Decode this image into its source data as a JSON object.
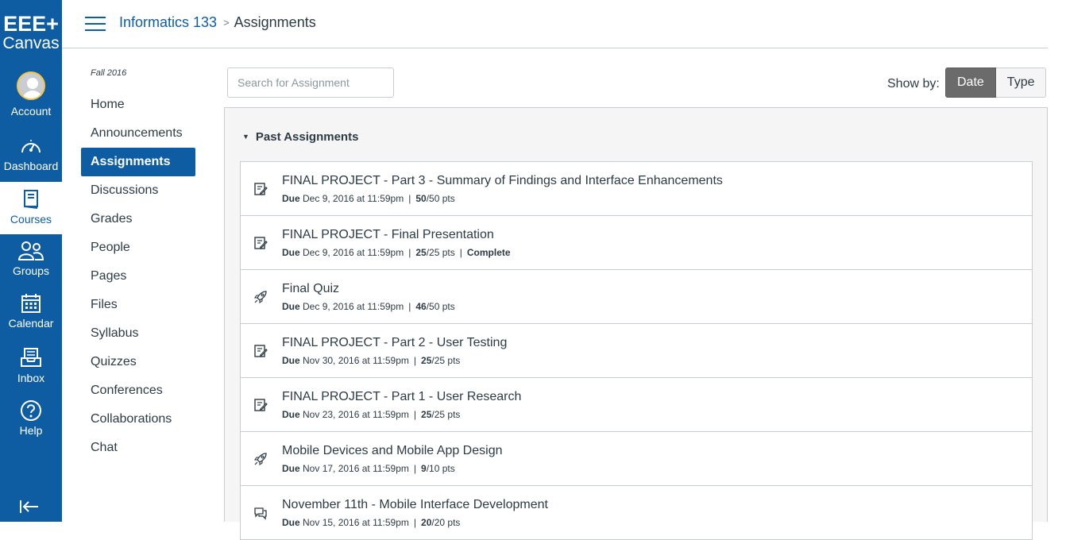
{
  "brand": {
    "line1": "EEE+",
    "line2": "Canvas"
  },
  "global_nav": [
    {
      "label": "Account",
      "icon": "avatar-icon"
    },
    {
      "label": "Dashboard",
      "icon": "dashboard-icon"
    },
    {
      "label": "Courses",
      "icon": "courses-icon"
    },
    {
      "label": "Groups",
      "icon": "groups-icon"
    },
    {
      "label": "Calendar",
      "icon": "calendar-icon"
    },
    {
      "label": "Inbox",
      "icon": "inbox-icon"
    },
    {
      "label": "Help",
      "icon": "help-icon"
    }
  ],
  "breadcrumb": {
    "course": "Informatics 133",
    "separator": ">",
    "page": "Assignments"
  },
  "course_nav": {
    "term": "Fall 2016",
    "items": [
      "Home",
      "Announcements",
      "Assignments",
      "Discussions",
      "Grades",
      "People",
      "Pages",
      "Files",
      "Syllabus",
      "Quizzes",
      "Conferences",
      "Collaborations",
      "Chat"
    ],
    "active": "Assignments"
  },
  "search": {
    "placeholder": "Search for Assignment",
    "value": ""
  },
  "show_by": {
    "label": "Show by:",
    "options": [
      "Date",
      "Type"
    ],
    "selected": "Date"
  },
  "group": {
    "title": "Past Assignments",
    "assignments": [
      {
        "title": "FINAL PROJECT - Part 3 - Summary of Findings and Interface Enhancements",
        "due_label": "Due",
        "due": "Dec 9, 2016 at 11:59pm",
        "score": "50",
        "points": "/50 pts",
        "status": "",
        "icon": "assignment-icon"
      },
      {
        "title": "FINAL PROJECT - Final Presentation",
        "due_label": "Due",
        "due": "Dec 9, 2016 at 11:59pm",
        "score": "25",
        "points": "/25 pts",
        "status": "Complete",
        "icon": "assignment-icon"
      },
      {
        "title": "Final Quiz",
        "due_label": "Due",
        "due": "Dec 9, 2016 at 11:59pm",
        "score": "46",
        "points": "/50 pts",
        "status": "",
        "icon": "quiz-icon"
      },
      {
        "title": "FINAL PROJECT - Part 2 - User Testing",
        "due_label": "Due",
        "due": "Nov 30, 2016 at 11:59pm",
        "score": "25",
        "points": "/25 pts",
        "status": "",
        "icon": "assignment-icon"
      },
      {
        "title": "FINAL PROJECT - Part 1 - User Research",
        "due_label": "Due",
        "due": "Nov 23, 2016 at 11:59pm",
        "score": "25",
        "points": "/25 pts",
        "status": "",
        "icon": "assignment-icon"
      },
      {
        "title": "Mobile Devices and Mobile App Design",
        "due_label": "Due",
        "due": "Nov 17, 2016 at 11:59pm",
        "score": "9",
        "points": "/10 pts",
        "status": "",
        "icon": "quiz-icon"
      },
      {
        "title": "November 11th - Mobile Interface Development",
        "due_label": "Due",
        "due": "Nov 15, 2016 at 11:59pm",
        "score": "20",
        "points": "/20 pts",
        "status": "",
        "icon": "discussion-icon"
      }
    ]
  },
  "colors": {
    "brand": "#0e5da3",
    "text": "#2d3b45",
    "border": "#c7cdd1",
    "toggle_on": "#6b6b6b"
  }
}
